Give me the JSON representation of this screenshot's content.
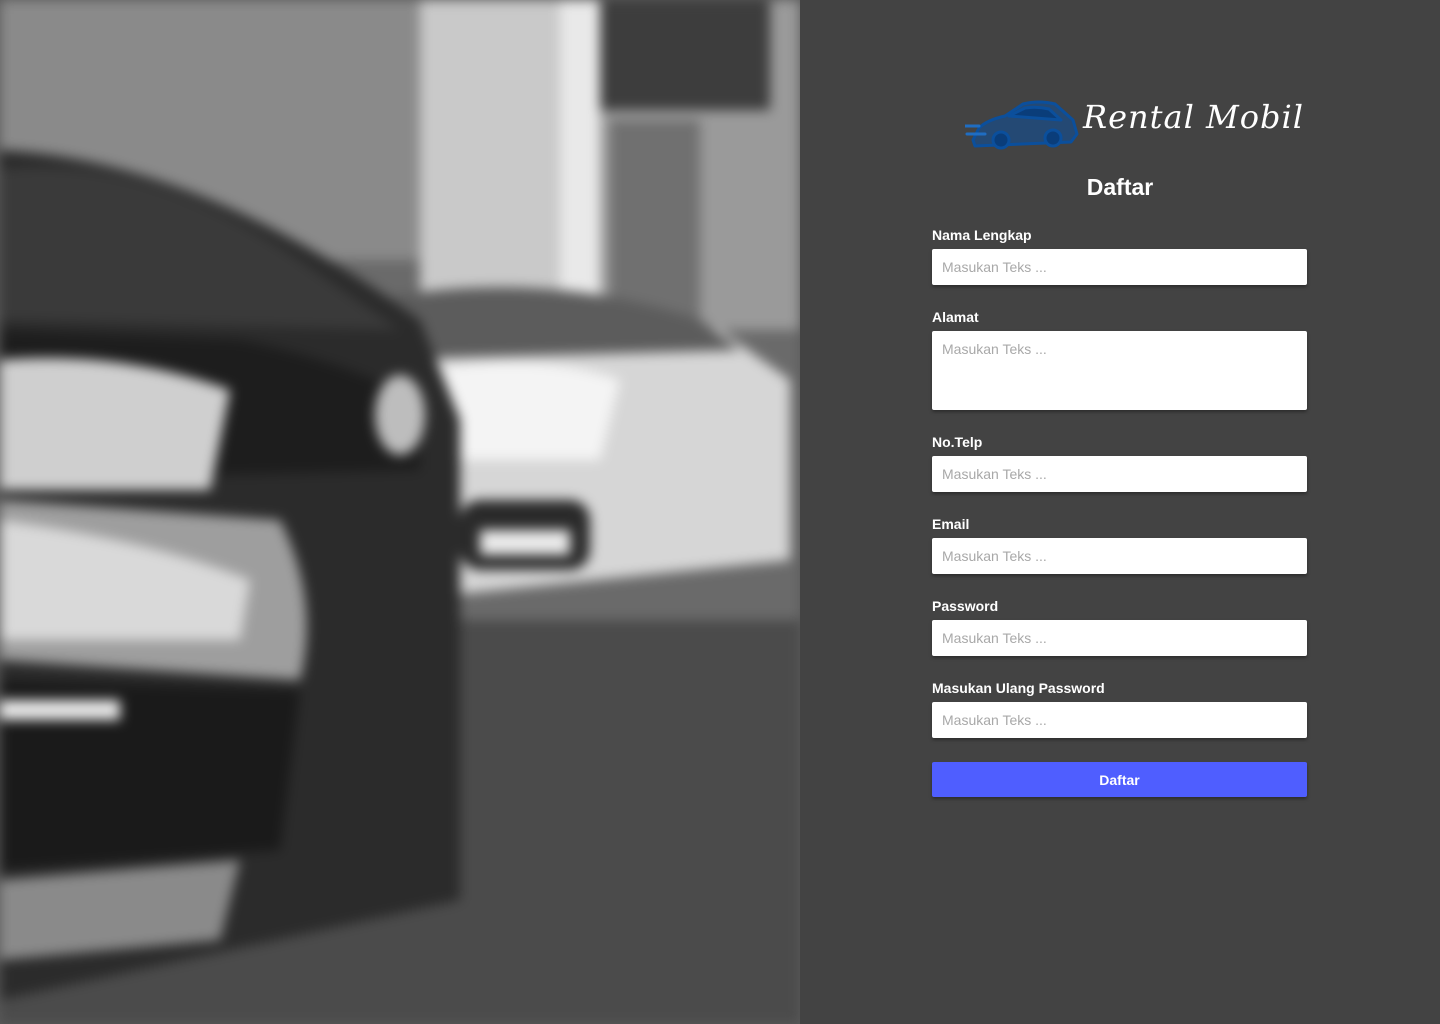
{
  "brand": {
    "name": "Rental Mobil",
    "logo_icon": "car-icon",
    "logo_color": "#0b4f9c"
  },
  "form": {
    "title": "Daftar",
    "fields": [
      {
        "label": "Nama Lengkap",
        "placeholder": "Masukan Teks ...",
        "value": ""
      },
      {
        "label": "Alamat",
        "placeholder": "Masukan Teks ...",
        "value": ""
      },
      {
        "label": "No.Telp",
        "placeholder": "Masukan Teks ...",
        "value": ""
      },
      {
        "label": "Email",
        "placeholder": "Masukan Teks ...",
        "value": ""
      },
      {
        "label": "Password",
        "placeholder": "Masukan Teks ...",
        "value": ""
      },
      {
        "label": "Masukan Ulang Password",
        "placeholder": "Masukan Teks ...",
        "value": ""
      }
    ],
    "submit_label": "Daftar"
  },
  "colors": {
    "panel_bg": "#434343",
    "accent": "#4f5eff"
  }
}
